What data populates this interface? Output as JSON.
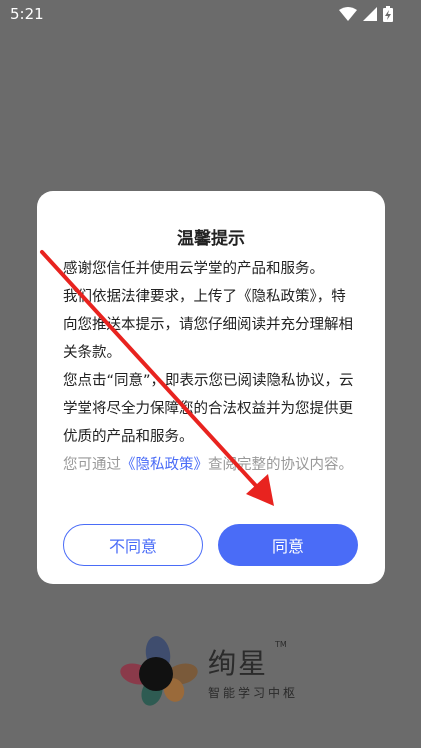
{
  "status_bar": {
    "time": "5:21",
    "icons": [
      "wifi-icon",
      "signal-icon",
      "battery-charging-icon"
    ]
  },
  "dialog": {
    "title": "温馨提示",
    "paragraphs": [
      "感谢您信任并使用云学堂的产品和服务。",
      "我们依据法律要求，上传了《隐私政策》，特向您推送本提示，请您仔细阅读并充分理解相关条款。",
      "您点击“同意”，即表示您已阅读隐私协议，云学堂将尽全力保障您的合法权益并为您提供更优质的产品和服务。"
    ],
    "note_prefix": "您可通过",
    "note_link": "《隐私政策》",
    "note_suffix": "查阅完整的协议内容。",
    "disagree_label": "不同意",
    "agree_label": "同意"
  },
  "logo": {
    "name": "绚星",
    "trademark": "TM",
    "subtitle": "智能学习中枢"
  },
  "colors": {
    "accent": "#4a6cf7",
    "overlay": "#6b6b6b",
    "arrow": "#e8231f"
  }
}
